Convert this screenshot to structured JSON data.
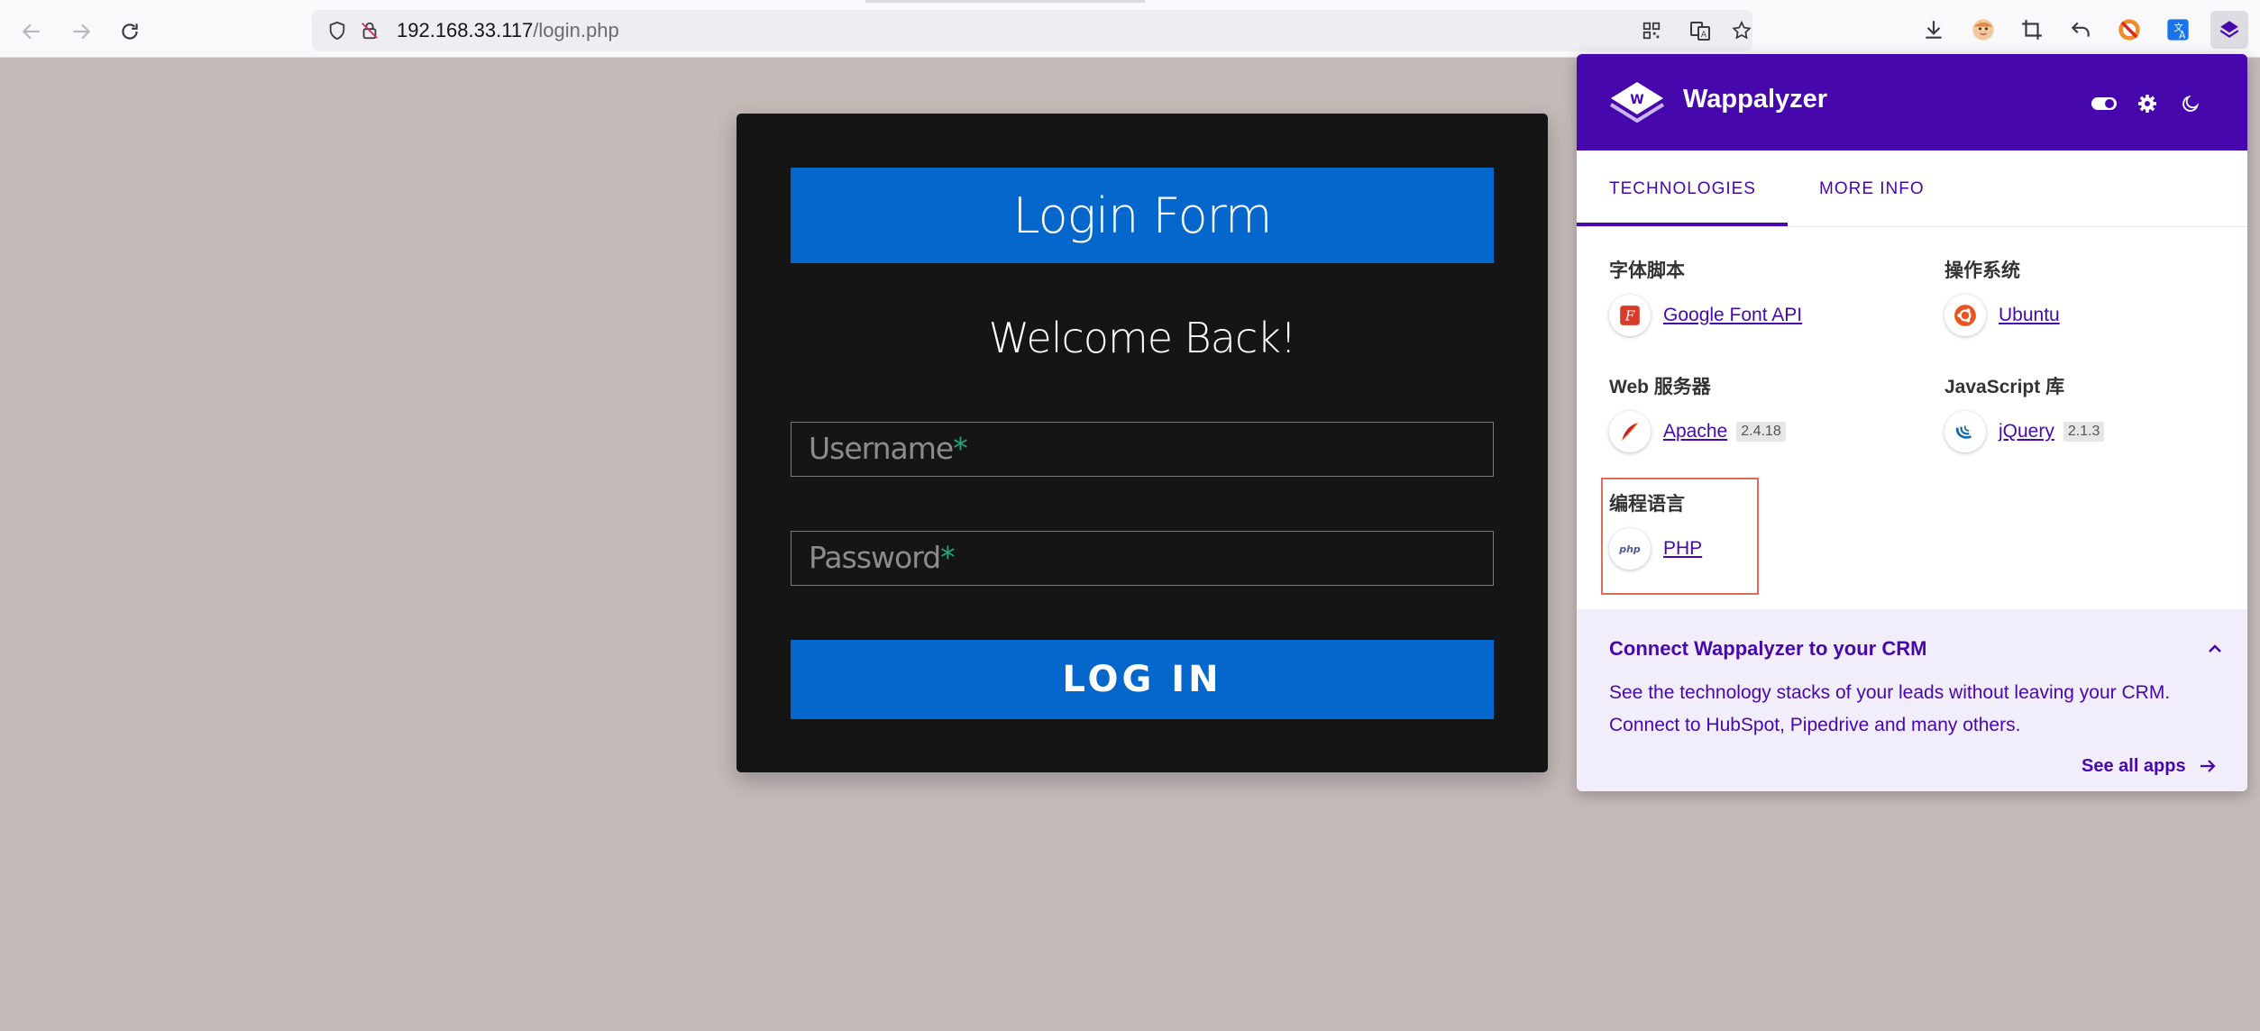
{
  "browser": {
    "url_host": "192.168.33.117",
    "url_path": "/login.php",
    "icons": [
      "back-icon",
      "forward-icon",
      "reload-icon",
      "shield-icon",
      "insecure-lock-icon",
      "qr-code-icon",
      "translate-icon",
      "star-icon",
      "download-icon",
      "avatar-icon",
      "crop-icon",
      "undo-icon",
      "blocker-icon",
      "translate-extension-icon",
      "wappalyzer-extension-icon"
    ]
  },
  "login": {
    "title": "Login Form",
    "welcome": "Welcome Back!",
    "username_placeholder": "Username",
    "password_placeholder": "Password",
    "required_mark": "*",
    "submit_label": "LOG IN"
  },
  "wappalyzer": {
    "brand": "Wappalyzer",
    "header_icons": [
      "toggle-icon",
      "settings-icon",
      "dark-mode-icon"
    ],
    "tabs": [
      "TECHNOLOGIES",
      "MORE INFO"
    ],
    "active_tab": "TECHNOLOGIES",
    "categories": [
      {
        "name": "字体脚本",
        "techs": [
          {
            "name": "Google Font API",
            "version": ""
          }
        ]
      },
      {
        "name": "操作系统",
        "techs": [
          {
            "name": "Ubuntu",
            "version": ""
          }
        ]
      },
      {
        "name": "Web 服务器",
        "techs": [
          {
            "name": "Apache",
            "version": "2.4.18"
          }
        ]
      },
      {
        "name": "JavaScript 库",
        "techs": [
          {
            "name": "jQuery",
            "version": "2.1.3"
          }
        ]
      },
      {
        "name": "编程语言",
        "techs": [
          {
            "name": "PHP",
            "version": ""
          }
        ]
      }
    ],
    "crm": {
      "title": "Connect Wappalyzer to your CRM",
      "text": "See the technology stacks of your leads without leaving your CRM. Connect to HubSpot, Pipedrive and many others.",
      "link": "See all apps"
    }
  },
  "colors": {
    "page_bg": "#c4bab8",
    "card_bg": "#151515",
    "accent_blue": "#0566cc",
    "required_green": "#1fa67a",
    "wappalyzer_purple": "#4608ad",
    "highlight_red": "#e26a5a"
  }
}
